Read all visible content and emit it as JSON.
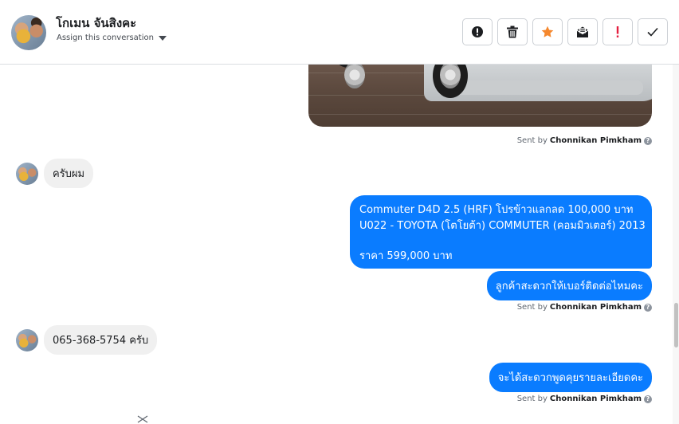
{
  "header": {
    "contact_name": "โกเมน จันสิงคะ",
    "assign_label": "Assign this conversation"
  },
  "toolbar": {
    "buttons": [
      {
        "name": "spam-button",
        "icon": "alert-circle-icon"
      },
      {
        "name": "delete-button",
        "icon": "trash-icon"
      },
      {
        "name": "star-button",
        "icon": "star-icon",
        "color": "#f5882e"
      },
      {
        "name": "mark-unread-button",
        "icon": "envelope-icon"
      },
      {
        "name": "mark-important-button",
        "icon": "exclamation-icon",
        "color": "#e41e3f"
      },
      {
        "name": "mark-done-button",
        "icon": "check-icon"
      }
    ]
  },
  "thread": {
    "sent_by_prefix": "Sent by",
    "agent_name": "Chonnikan Pimkham",
    "messages": [
      {
        "type": "image",
        "direction": "out",
        "alt": "car-photo"
      },
      {
        "type": "text",
        "direction": "in",
        "text": "ครับผม"
      },
      {
        "type": "text",
        "direction": "out",
        "lines": [
          "Commuter D4D 2.5 (HRF) โปรข้าวแลกลด 100,000 บาท",
          "U022 - TOYOTA (โตโยต้า) COMMUTER (คอมมิวเตอร์) 2013",
          "",
          "ราคา 599,000 บาท"
        ]
      },
      {
        "type": "text",
        "direction": "out",
        "text": "ลูกค้าสะดวกให้เบอร์ติดต่อไหมคะ"
      },
      {
        "type": "text",
        "direction": "in",
        "text": "065-368-5754 ครับ"
      },
      {
        "type": "text",
        "direction": "out",
        "text": "จะได้สะดวกพูดคุยรายละเอียดคะ"
      }
    ]
  },
  "colors": {
    "outgoing_bubble": "#0a7cff",
    "incoming_bubble": "#f0f0f0"
  }
}
